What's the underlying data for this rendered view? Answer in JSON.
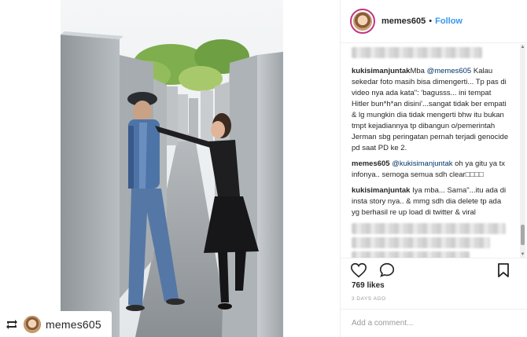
{
  "repost": {
    "username": "memes605",
    "icon": "repost-icon"
  },
  "header": {
    "username": "memes605",
    "separator": "•",
    "follow_label": "Follow"
  },
  "comments": [
    {
      "user": "kukisimanjuntak",
      "pre": "Mba ",
      "mention": "@memes605",
      "text": " Kalau sekedar foto masih bisa dimengerti... Tp pas di video nya ada kata\": 'bagusss... ini tempat Hitler bun*h*an disini'...sangat tidak ber empati & lg mungkin dia tidak mengerti bhw itu bukan tmpt kejadiannya tp dibangun o/pemerintah Jerman sbg peringatan pernah terjadi genocide pd saat PD ke 2."
    },
    {
      "user": "memes605",
      "pre": " ",
      "mention": "@kukisimanjuntak",
      "text": " oh ya gitu ya tx infonya.. semoga semua sdh clear□□□□"
    },
    {
      "user": "kukisimanjuntak",
      "pre": " Iya mba... Sama\"...itu ada di insta story nya.. & mmg sdh dia delete tp ada yg berhasil re up load di twitter & viral",
      "mention": "",
      "text": ""
    }
  ],
  "actions": {
    "like_icon": "heart-icon",
    "comment_icon": "comment-icon",
    "save_icon": "bookmark-icon"
  },
  "likes_label": "769 likes",
  "time_label": "3 DAYS AGO",
  "add_comment_placeholder": "Add a comment...",
  "colors": {
    "follow": "#3897f0",
    "mention": "#003569",
    "avatar_ring": "#c13584"
  }
}
